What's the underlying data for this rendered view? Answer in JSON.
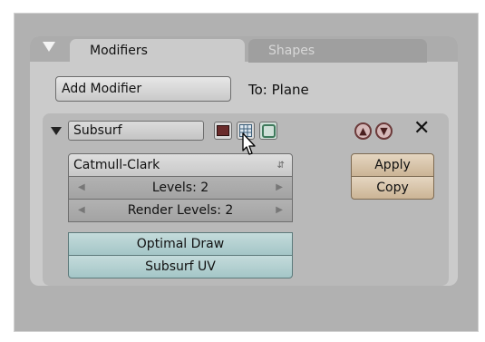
{
  "tabs": [
    {
      "label": "Modifiers"
    },
    {
      "label": "Shapes"
    }
  ],
  "add_modifier": {
    "label": "Add Modifier"
  },
  "target": {
    "label": "To: Plane"
  },
  "modifier": {
    "name": "Subsurf",
    "type_select": {
      "value": "Catmull-Clark"
    },
    "levels": {
      "label": "Levels: 2"
    },
    "render_levels": {
      "label": "Render Levels: 2"
    },
    "optimal_draw": {
      "label": "Optimal Draw"
    },
    "subsurf_uv": {
      "label": "Subsurf UV"
    },
    "apply_label": "Apply",
    "copy_label": "Copy"
  },
  "icons": {
    "collapse": "triangle-down-icon",
    "render": "render-icon",
    "editmode": "grid-icon",
    "cage": "cage-icon",
    "move_up": "chevron-up-icon",
    "move_down": "chevron-down-icon",
    "remove": "close-icon",
    "pointer": "mouse-cursor-icon"
  },
  "colors": {
    "panel": "#cbcbcb",
    "apply_button": "#d8c3a6",
    "toggle_button": "#b4d0d1",
    "render_icon": "#6a2b2b"
  }
}
